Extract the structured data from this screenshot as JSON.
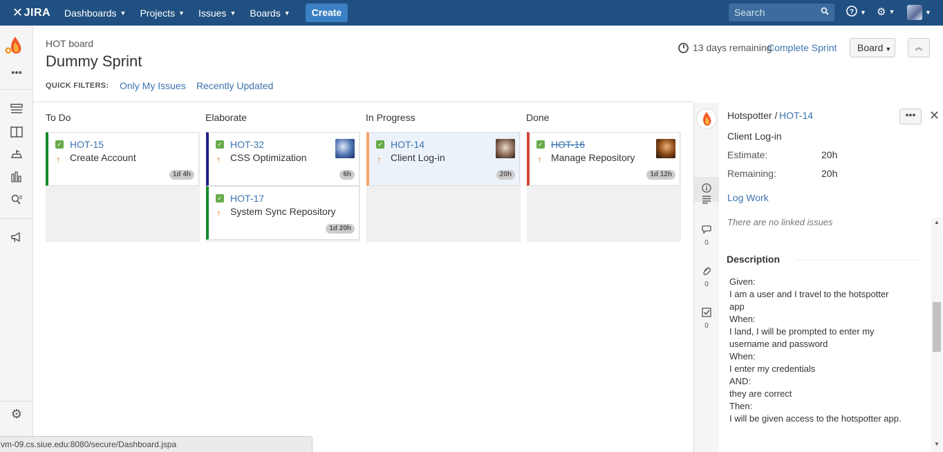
{
  "header": {
    "logo": "JIRA",
    "nav": [
      "Dashboards",
      "Projects",
      "Issues",
      "Boards"
    ],
    "create": "Create",
    "search_placeholder": "Search"
  },
  "board": {
    "project": "HOT board",
    "sprint": "Dummy Sprint",
    "quick_filters_label": "QUICK FILTERS:",
    "quick_filters": [
      "Only My Issues",
      "Recently Updated"
    ],
    "time_remaining": "13 days remaining",
    "complete_sprint": "Complete Sprint",
    "board_button": "Board"
  },
  "columns": [
    {
      "name": "To Do"
    },
    {
      "name": "Elaborate"
    },
    {
      "name": "In Progress"
    },
    {
      "name": "Done"
    }
  ],
  "cards": [
    {
      "key": "HOT-15",
      "summary": "Create Account",
      "estimate": "1d 4h",
      "column": "To Do",
      "status_color": "#14892c"
    },
    {
      "key": "HOT-32",
      "summary": "CSS Optimization",
      "estimate": "6h",
      "column": "Elaborate",
      "status_color": "#1f1f8c"
    },
    {
      "key": "HOT-17",
      "summary": "System Sync Repository",
      "estimate": "1d 20h",
      "column": "Elaborate",
      "status_color": "#14892c"
    },
    {
      "key": "HOT-14",
      "summary": "Client Log-in",
      "estimate": "20h",
      "column": "In Progress",
      "status_color": "#f6a26b"
    },
    {
      "key": "HOT-16",
      "summary": "Manage Repository",
      "estimate": "1d 12h",
      "column": "Done",
      "status_color": "#d04437"
    }
  ],
  "detail": {
    "project": "Hotspotter /",
    "key": "HOT-14",
    "summary": "Client Log-in",
    "estimate_label": "Estimate:",
    "estimate": "20h",
    "remaining_label": "Remaining:",
    "remaining": "20h",
    "log_work": "Log Work",
    "linked": "There are no linked issues",
    "description_heading": "Description",
    "description": [
      "Given:",
      "I am a user and I travel to the hotspotter",
      "app",
      "When:",
      "I land, I will be prompted to enter my",
      "username and password",
      "When:",
      "I enter my credentials",
      "AND:",
      "they are correct",
      "Then:",
      "I will be given access to the hotspotter app."
    ],
    "comments_count": "0",
    "attachments_count": "0",
    "subtasks_count": "0"
  },
  "status_bar": "vm-09.cs.siue.edu:8080/secure/Dashboard.jspa"
}
